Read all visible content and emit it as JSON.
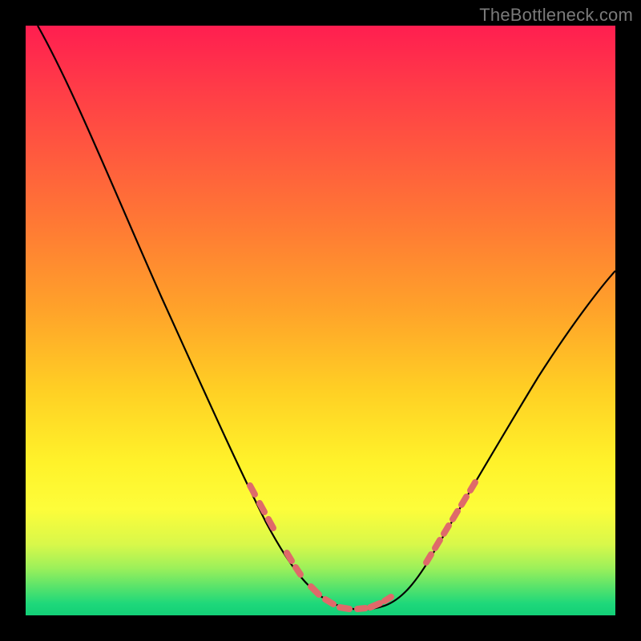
{
  "watermark": "TheBottleneck.com",
  "chart_data": {
    "type": "line",
    "title": "",
    "xlabel": "",
    "ylabel": "",
    "xlim": [
      0,
      100
    ],
    "ylim": [
      0,
      100
    ],
    "grid": false,
    "legend": false,
    "background_gradient": {
      "orientation": "vertical",
      "stops": [
        {
          "pos": 0.0,
          "color": "#ff1e50"
        },
        {
          "pos": 0.35,
          "color": "#ff7a34"
        },
        {
          "pos": 0.62,
          "color": "#ffd024"
        },
        {
          "pos": 0.82,
          "color": "#fdfd3a"
        },
        {
          "pos": 0.95,
          "color": "#5ce46a"
        },
        {
          "pos": 1.0,
          "color": "#13cf77"
        }
      ]
    },
    "series": [
      {
        "name": "curve",
        "color": "#000000",
        "x": [
          2,
          8,
          14,
          20,
          26,
          32,
          38,
          44,
          48,
          52,
          56,
          60,
          64,
          68,
          72,
          78,
          86,
          94,
          100
        ],
        "y": [
          100,
          90,
          79,
          68,
          57,
          46,
          35,
          22,
          12,
          4,
          1,
          1,
          4,
          12,
          20,
          30,
          42,
          52,
          58
        ]
      },
      {
        "name": "dots",
        "type": "scatter",
        "color": "#e06666",
        "x": [
          38,
          39.5,
          41,
          44.5,
          45.5,
          48,
          50,
          52,
          54,
          55,
          57,
          58.5,
          60,
          61,
          68,
          70,
          71.5,
          73,
          74.5,
          76
        ],
        "y": [
          35,
          32,
          29,
          20,
          18,
          12,
          7,
          4,
          2,
          1.5,
          1,
          1,
          1.2,
          2,
          12,
          16,
          19,
          21,
          24,
          27
        ]
      }
    ]
  }
}
